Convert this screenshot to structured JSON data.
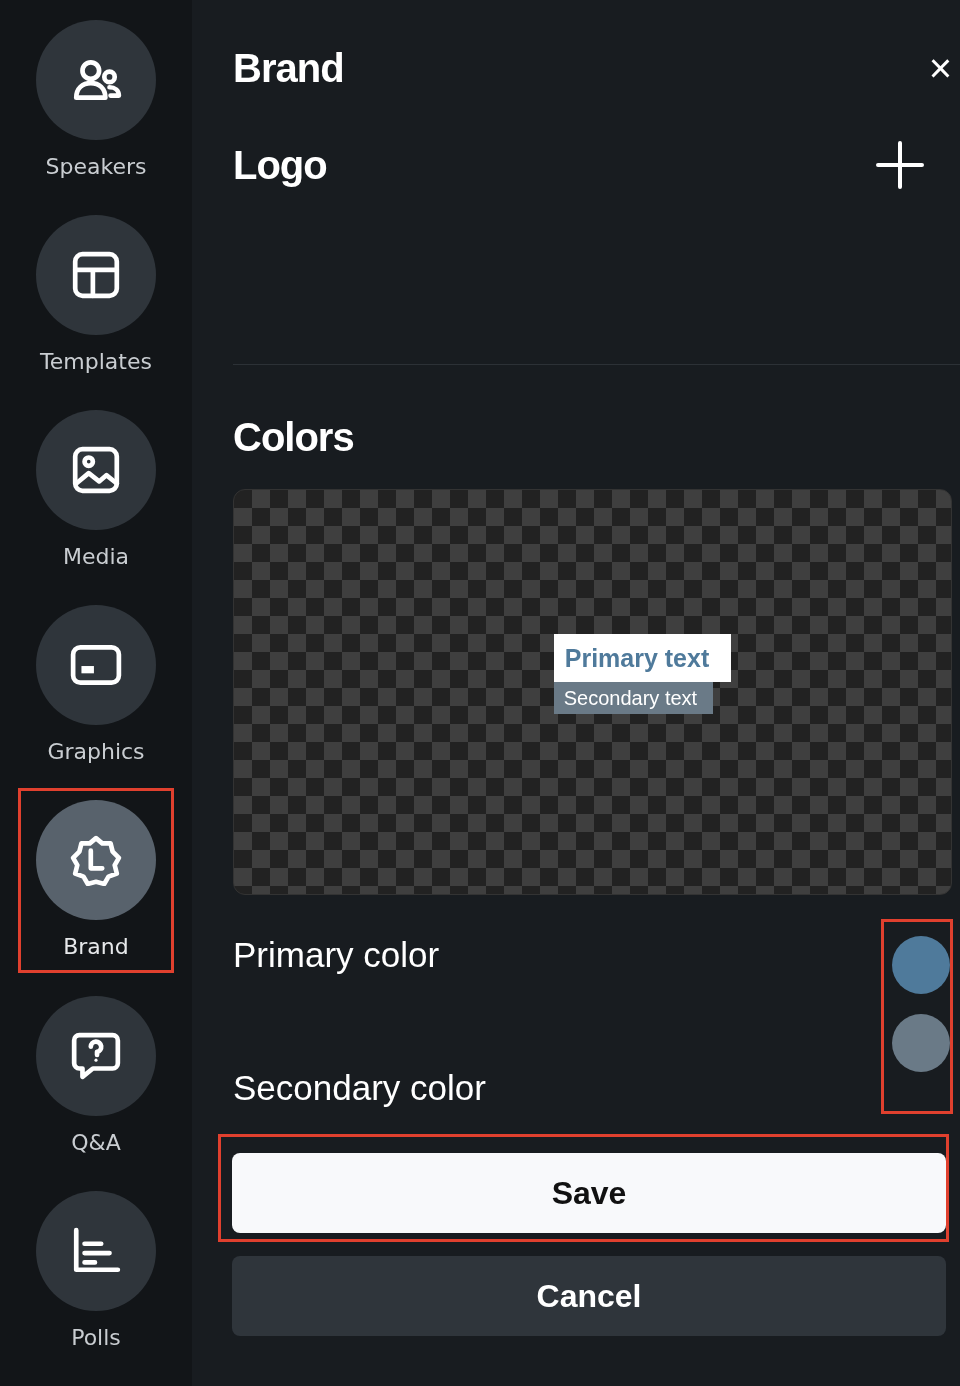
{
  "sidebar": {
    "items": [
      {
        "label": "Speakers",
        "selected": false,
        "highlighted": false
      },
      {
        "label": "Templates",
        "selected": false,
        "highlighted": false
      },
      {
        "label": "Media",
        "selected": false,
        "highlighted": false
      },
      {
        "label": "Graphics",
        "selected": false,
        "highlighted": false
      },
      {
        "label": "Brand",
        "selected": true,
        "highlighted": true
      },
      {
        "label": "Q&A",
        "selected": false,
        "highlighted": false
      },
      {
        "label": "Polls",
        "selected": false,
        "highlighted": false
      }
    ]
  },
  "panel": {
    "title": "Brand",
    "close": "×",
    "logo": {
      "heading": "Logo"
    },
    "colors": {
      "heading": "Colors",
      "preview": {
        "primary_text": "Primary text",
        "secondary_text": "Secondary text"
      },
      "swatches_highlighted": true,
      "items": [
        {
          "label": "Primary color",
          "color": "#4f7a9b"
        },
        {
          "label": "Secondary color",
          "color": "#6a7a87"
        }
      ]
    },
    "buttons": [
      {
        "label": "Save",
        "kind": "primary",
        "highlighted": true
      },
      {
        "label": "Cancel",
        "kind": "secondary",
        "highlighted": false
      }
    ]
  }
}
